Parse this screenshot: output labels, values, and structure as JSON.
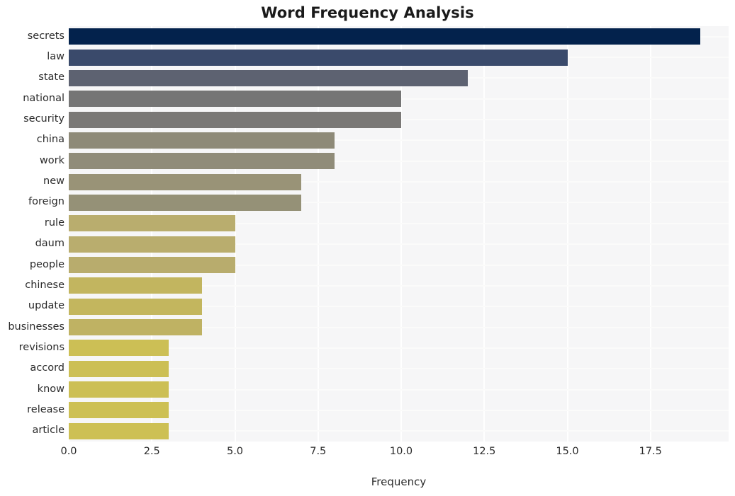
{
  "chart_data": {
    "type": "bar",
    "orientation": "horizontal",
    "title": "Word Frequency Analysis",
    "xlabel": "Frequency",
    "ylabel": "",
    "categories": [
      "secrets",
      "law",
      "state",
      "national",
      "security",
      "china",
      "work",
      "new",
      "foreign",
      "rule",
      "daum",
      "people",
      "chinese",
      "update",
      "businesses",
      "revisions",
      "accord",
      "know",
      "release",
      "article"
    ],
    "values": [
      19,
      15,
      12,
      10,
      10,
      8,
      8,
      7,
      7,
      5,
      5,
      5,
      4,
      4,
      4,
      3,
      3,
      3,
      3,
      3
    ],
    "bar_colors": [
      "#03224c",
      "#3a4a6b",
      "#5d6271",
      "#757575",
      "#7a7876",
      "#8e8a78",
      "#908c79",
      "#999377",
      "#959177",
      "#b9ad6e",
      "#b9ad6e",
      "#b8ac6d",
      "#c2b55f",
      "#c3b65e",
      "#bfb263",
      "#ccbf55",
      "#ccbf55",
      "#ccbf55",
      "#cdc054",
      "#cdc054"
    ],
    "xlim": [
      0,
      19.85
    ],
    "xticks": [
      "0.0",
      "2.5",
      "5.0",
      "7.5",
      "10.0",
      "12.5",
      "15.0",
      "17.5"
    ],
    "xtick_values": [
      0,
      2.5,
      5,
      7.5,
      10,
      12.5,
      15,
      17.5
    ],
    "grid": true,
    "grid_color": "#ffffff",
    "plot_background": "#f6f6f7",
    "figure_background": "#ffffff",
    "legend": null
  }
}
